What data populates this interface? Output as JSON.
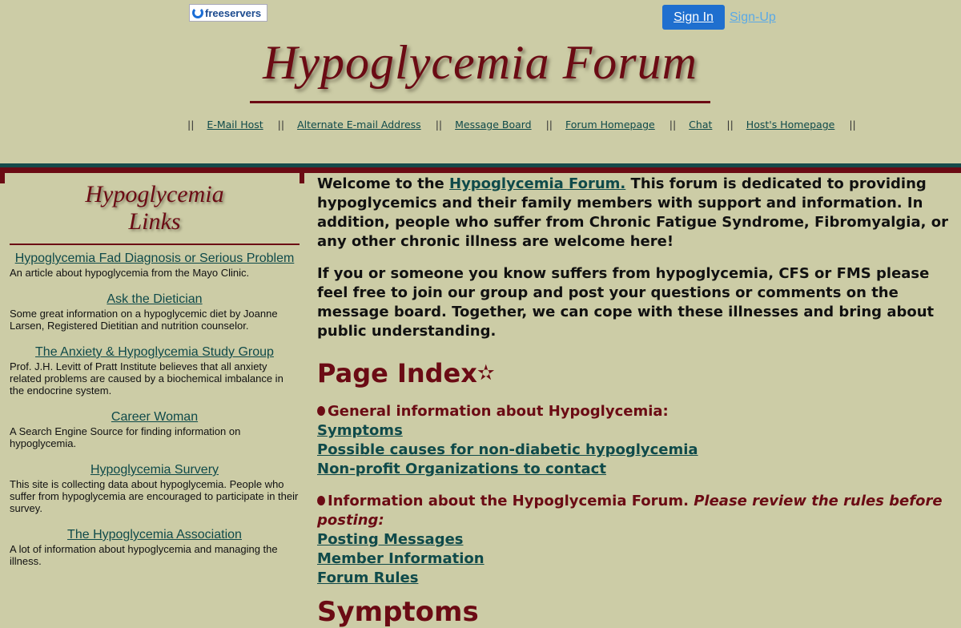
{
  "header": {
    "logo_text": "freeservers",
    "sign_in": "Sign In",
    "sign_up": "Sign-Up",
    "title": "Hypoglycemia Forum",
    "nav_sep": "||",
    "nav": [
      "E-Mail Host",
      "Alternate E-mail Address",
      "Message Board",
      "Forum Homepage",
      "Chat",
      "Host's Homepage"
    ]
  },
  "sidebar": {
    "title_line1": "Hypoglycemia",
    "title_line2": "Links",
    "items": [
      {
        "link": "Hypoglycemia Fad Diagnosis or Serious Problem",
        "desc": "An article about hypoglycemia from the Mayo Clinic."
      },
      {
        "link": "Ask the Dietician",
        "desc": "Some great information on a hypoglycemic diet by Joanne Larsen, Registered Dietitian and nutrition counselor."
      },
      {
        "link": "The Anxiety & Hypoglycemia Study Group",
        "desc": "Prof. J.H. Levitt of Pratt Institute believes that all anxiety related problems are caused by a biochemical imbalance in the endocrine system."
      },
      {
        "link": "Career Woman",
        "desc": "A Search Engine Source for finding information on hypoglycemia."
      },
      {
        "link": "Hypoglycemia Survery",
        "desc": "This site is collecting data about hypoglycemia. People who suffer from hypoglycemia are encouraged to participate in their survey."
      },
      {
        "link": "The Hypoglycemia Association",
        "desc": "A lot of information about hypoglycemia and managing the illness."
      }
    ]
  },
  "main": {
    "welcome_prefix": "Welcome to the ",
    "welcome_link": "Hypoglycemia Forum.",
    "welcome_rest": " This forum is dedicated to providing hypoglycemics and their family members with support and information. In addition, people who suffer from Chronic Fatigue Syndrome, Fibromyalgia, or any other chronic illness are welcome here!",
    "para2": "If you or someone you know suffers from hypoglycemia, CFS or FMS please feel free to join our group and post your questions or comments on the message board. Together, we can cope with these illnesses and bring about public understanding.",
    "index_title": "Page Index",
    "star": "✫",
    "sect1_title": "General information about Hypoglycemia:",
    "sect1_links": [
      "Symptoms",
      "Possible causes for non-diabetic hypoglycemia",
      "Non-profit Organizations to contact"
    ],
    "sect2_title": "Information about the Hypoglycemia Forum. ",
    "sect2_note": "Please review the rules before posting:",
    "sect2_links": [
      "Posting Messages",
      "Member Information",
      "Forum Rules"
    ],
    "symptoms_title": "Symptoms"
  },
  "colors": {
    "accent": "#6b0b14",
    "link": "#0f4a4a",
    "background": "#cccca6",
    "band": "#154b4b"
  }
}
